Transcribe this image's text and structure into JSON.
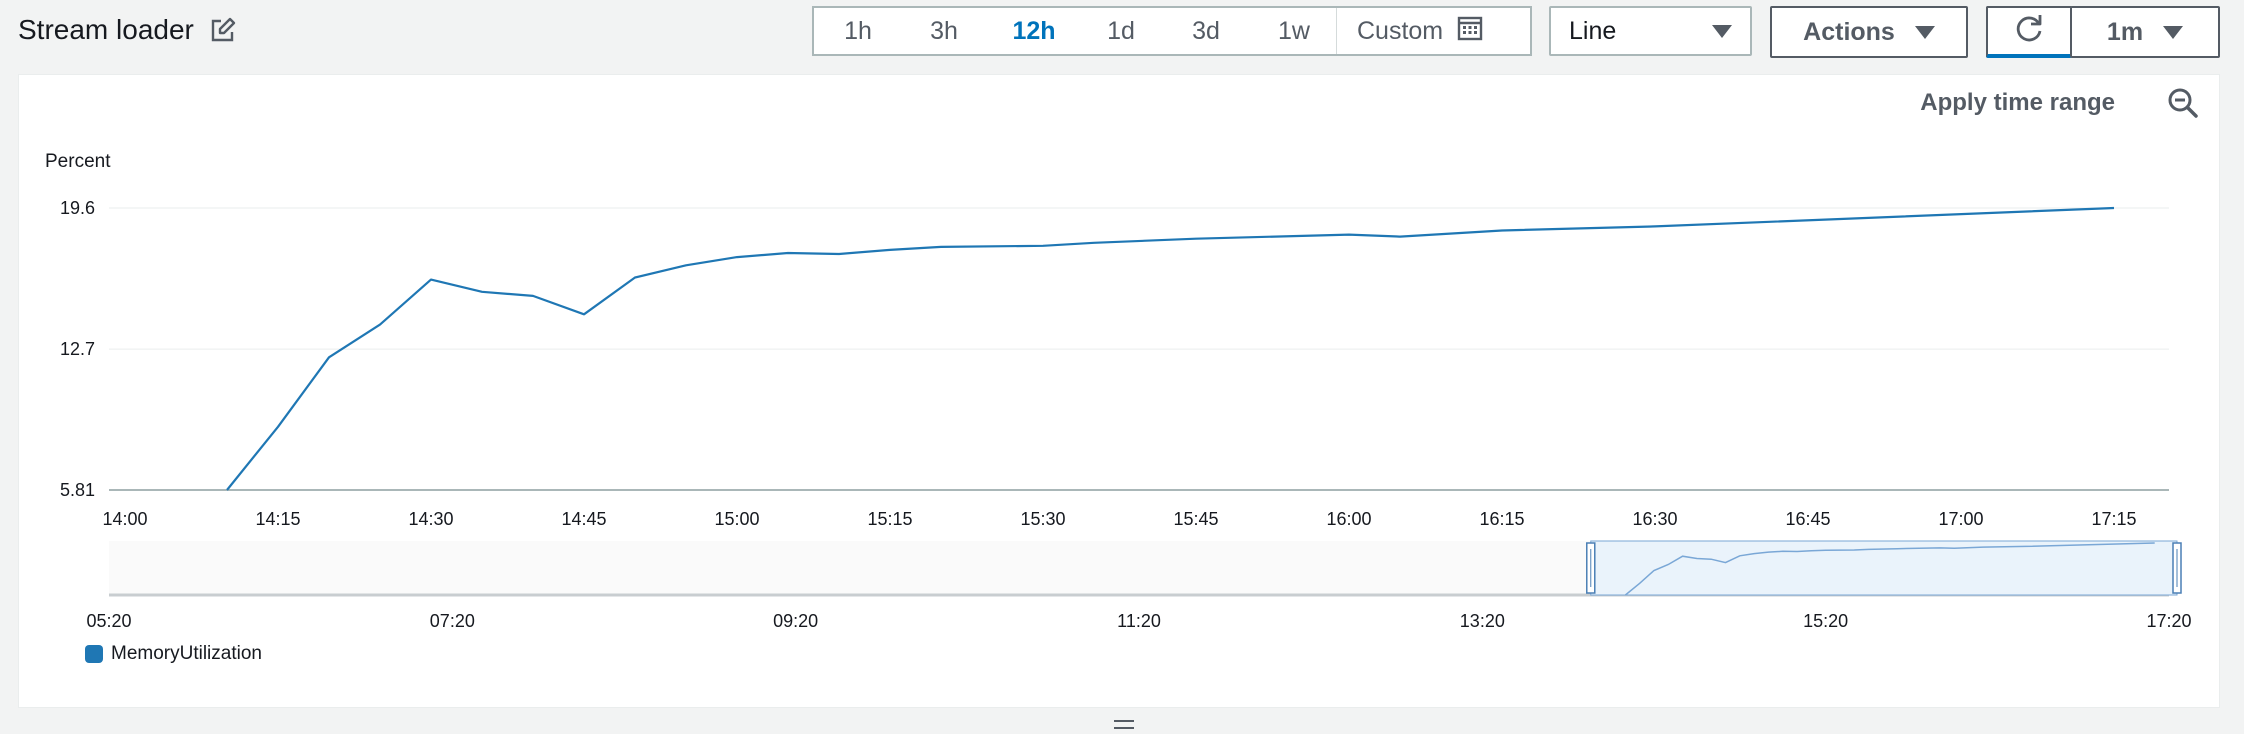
{
  "header": {
    "title": "Stream loader",
    "time_ranges": [
      "1h",
      "3h",
      "12h",
      "1d",
      "3d",
      "1w"
    ],
    "active_range": "12h",
    "custom_label": "Custom",
    "chart_type_selected": "Line",
    "actions_label": "Actions",
    "refresh_interval": "1m"
  },
  "panel": {
    "apply_time_range_label": "Apply time range"
  },
  "chart_data": {
    "type": "line",
    "ylabel": "Percent",
    "yticks": [
      5.81,
      12.7,
      19.6
    ],
    "ylim": [
      5.81,
      19.6
    ],
    "xticks": [
      "14:00",
      "14:15",
      "14:30",
      "14:45",
      "15:00",
      "15:15",
      "15:30",
      "15:45",
      "16:00",
      "16:15",
      "16:30",
      "16:45",
      "17:00",
      "17:15"
    ],
    "series": [
      {
        "name": "MemoryUtilization",
        "color": "#1f77b4",
        "points": [
          [
            "14:10",
            5.81
          ],
          [
            "14:15",
            8.9
          ],
          [
            "14:20",
            12.3
          ],
          [
            "14:25",
            13.9
          ],
          [
            "14:30",
            16.1
          ],
          [
            "14:35",
            15.5
          ],
          [
            "14:40",
            15.3
          ],
          [
            "14:45",
            14.4
          ],
          [
            "14:50",
            16.2
          ],
          [
            "14:55",
            16.8
          ],
          [
            "15:00",
            17.2
          ],
          [
            "15:05",
            17.4
          ],
          [
            "15:10",
            17.35
          ],
          [
            "15:15",
            17.55
          ],
          [
            "15:20",
            17.7
          ],
          [
            "15:30",
            17.75
          ],
          [
            "15:35",
            17.9
          ],
          [
            "15:45",
            18.1
          ],
          [
            "16:00",
            18.3
          ],
          [
            "16:05",
            18.2
          ],
          [
            "16:15",
            18.5
          ],
          [
            "16:30",
            18.7
          ],
          [
            "17:15",
            19.6
          ]
        ]
      }
    ],
    "overview": {
      "xticks": [
        "05:20",
        "07:20",
        "09:20",
        "11:20",
        "13:20",
        "15:20",
        "17:20"
      ]
    }
  }
}
